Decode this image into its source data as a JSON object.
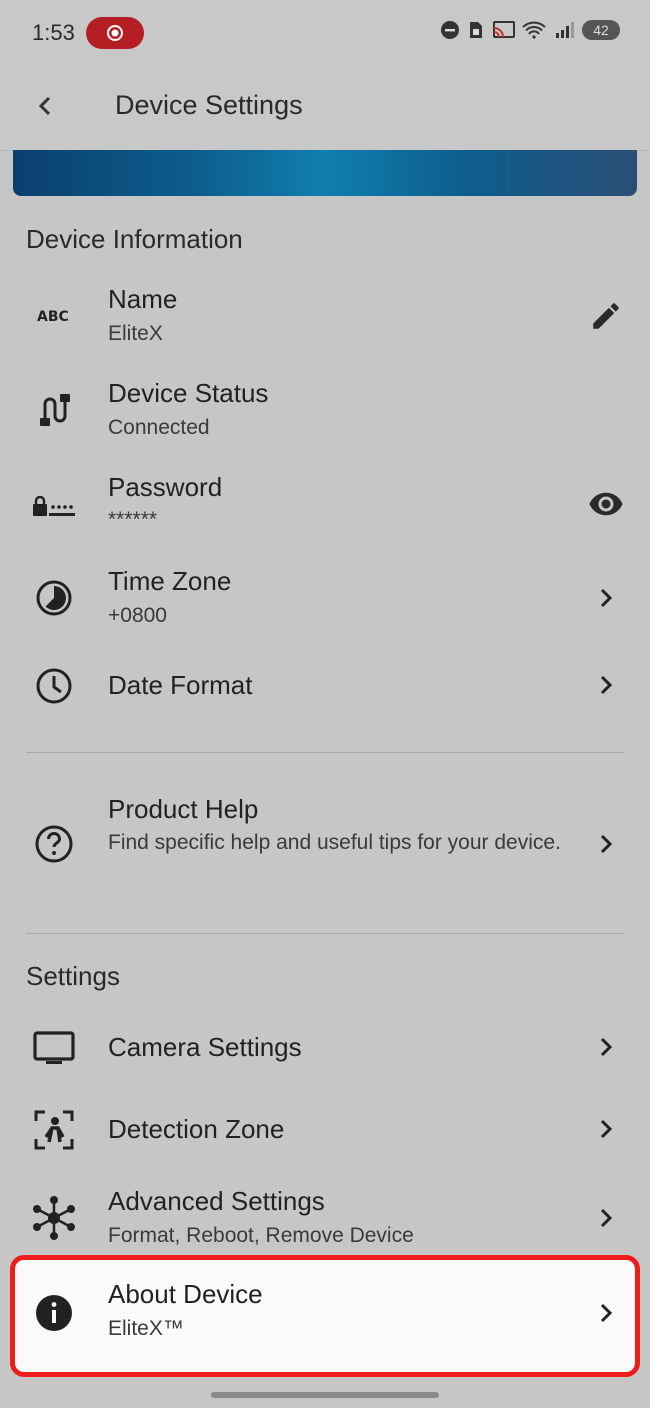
{
  "status_bar": {
    "time": "1:53",
    "battery": "42"
  },
  "app_bar": {
    "title": "Device Settings"
  },
  "device_info": {
    "header": "Device Information",
    "name": {
      "title": "Name",
      "value": "EliteX"
    },
    "status": {
      "title": "Device Status",
      "value": "Connected"
    },
    "password": {
      "title": "Password",
      "value": "******"
    },
    "timezone": {
      "title": "Time Zone",
      "value": "+0800"
    },
    "date_format": {
      "title": "Date Format"
    }
  },
  "product_help": {
    "title": "Product Help",
    "description": "Find specific help and useful tips for your device."
  },
  "settings": {
    "header": "Settings",
    "camera": {
      "title": "Camera Settings"
    },
    "detection": {
      "title": "Detection Zone"
    },
    "advanced": {
      "title": "Advanced Settings",
      "value": "Format, Reboot, Remove Device"
    },
    "about": {
      "title": "About Device",
      "value": "EliteX™"
    }
  },
  "colors": {
    "highlight_border": "#ee1c1c",
    "banner_blue": "#0f7fae"
  }
}
